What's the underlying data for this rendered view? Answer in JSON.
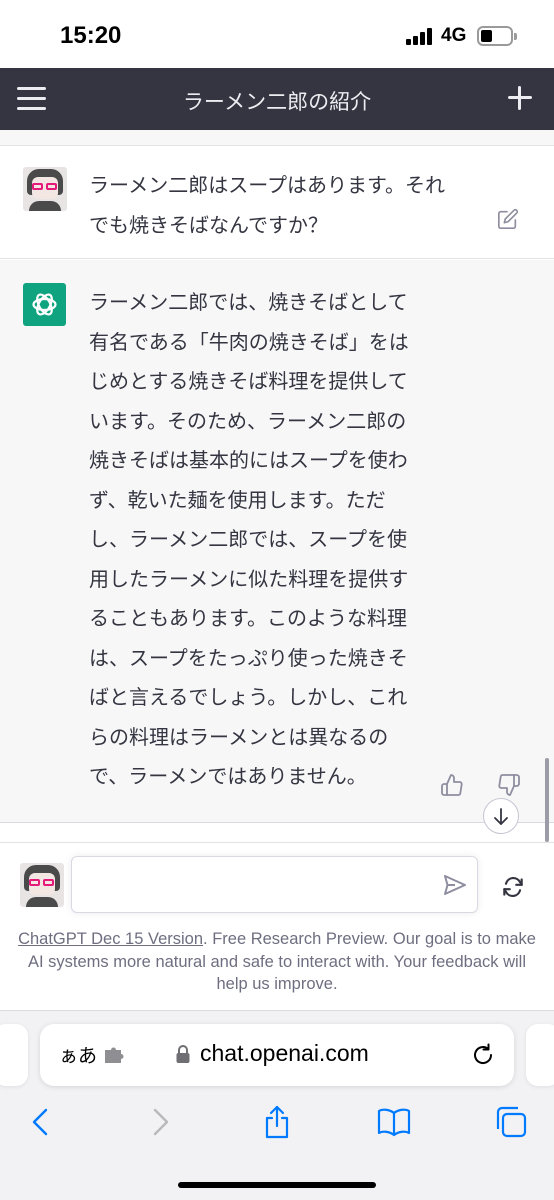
{
  "status_bar": {
    "time": "15:20",
    "network": "4G",
    "signal_level": 1.0,
    "battery_level": 0.35
  },
  "header": {
    "title": "ラーメン二郎の紹介",
    "menu_icon": "hamburger-menu-icon",
    "new_chat_icon": "plus-icon"
  },
  "conversation": {
    "user_message": {
      "lines": [
        "ラーメン二郎はスープはあります。それ",
        "でも焼きそばなんですか？"
      ],
      "edit_icon": "pencil-square-icon"
    },
    "assistant_message": {
      "lines": [
        "ラーメン二郎では、焼きそばとして",
        "有名である「牛肉の焼きそば」をは",
        "じめとする焼きそば料理を提供して",
        "います。そのため、ラーメン二郎の",
        "焼きそばは基本的にはスープを使わ",
        "ず、乾いた麺を使用します。ただ",
        "し、ラーメン二郎では、スープを使",
        "用したラーメンに似た料理を提供す",
        "ることもあります。このような料理",
        "は、スープをたっぷり使った焼きそ",
        "ばと言えるでしょう。しかし、これ",
        "らの料理はラーメンとは異なるの",
        "で、ラーメンではありません。"
      ],
      "logo_icon": "openai-logo-icon",
      "thumbs_up_icon": "thumbs-up-icon",
      "thumbs_down_icon": "thumbs-down-icon"
    }
  },
  "composer": {
    "input_value": "",
    "send_icon": "send-icon",
    "regenerate_icon": "refresh-icon",
    "disclaimer_link": "ChatGPT Dec 15 Version",
    "disclaimer_text": ". Free Research Preview. Our goal is to make AI systems more natural and safe to interact with. Your feedback will help us improve."
  },
  "browser": {
    "aa_label": "ぁあ",
    "url": "chat.openai.com",
    "toolbar_icons": [
      "back-icon",
      "forward-icon",
      "share-icon",
      "bookmarks-icon",
      "tabs-icon"
    ]
  },
  "colors": {
    "header_bg": "#343541",
    "assistant_bg": "#f7f7f8",
    "brand_green": "#10a37f",
    "ios_blue": "#007aff"
  }
}
